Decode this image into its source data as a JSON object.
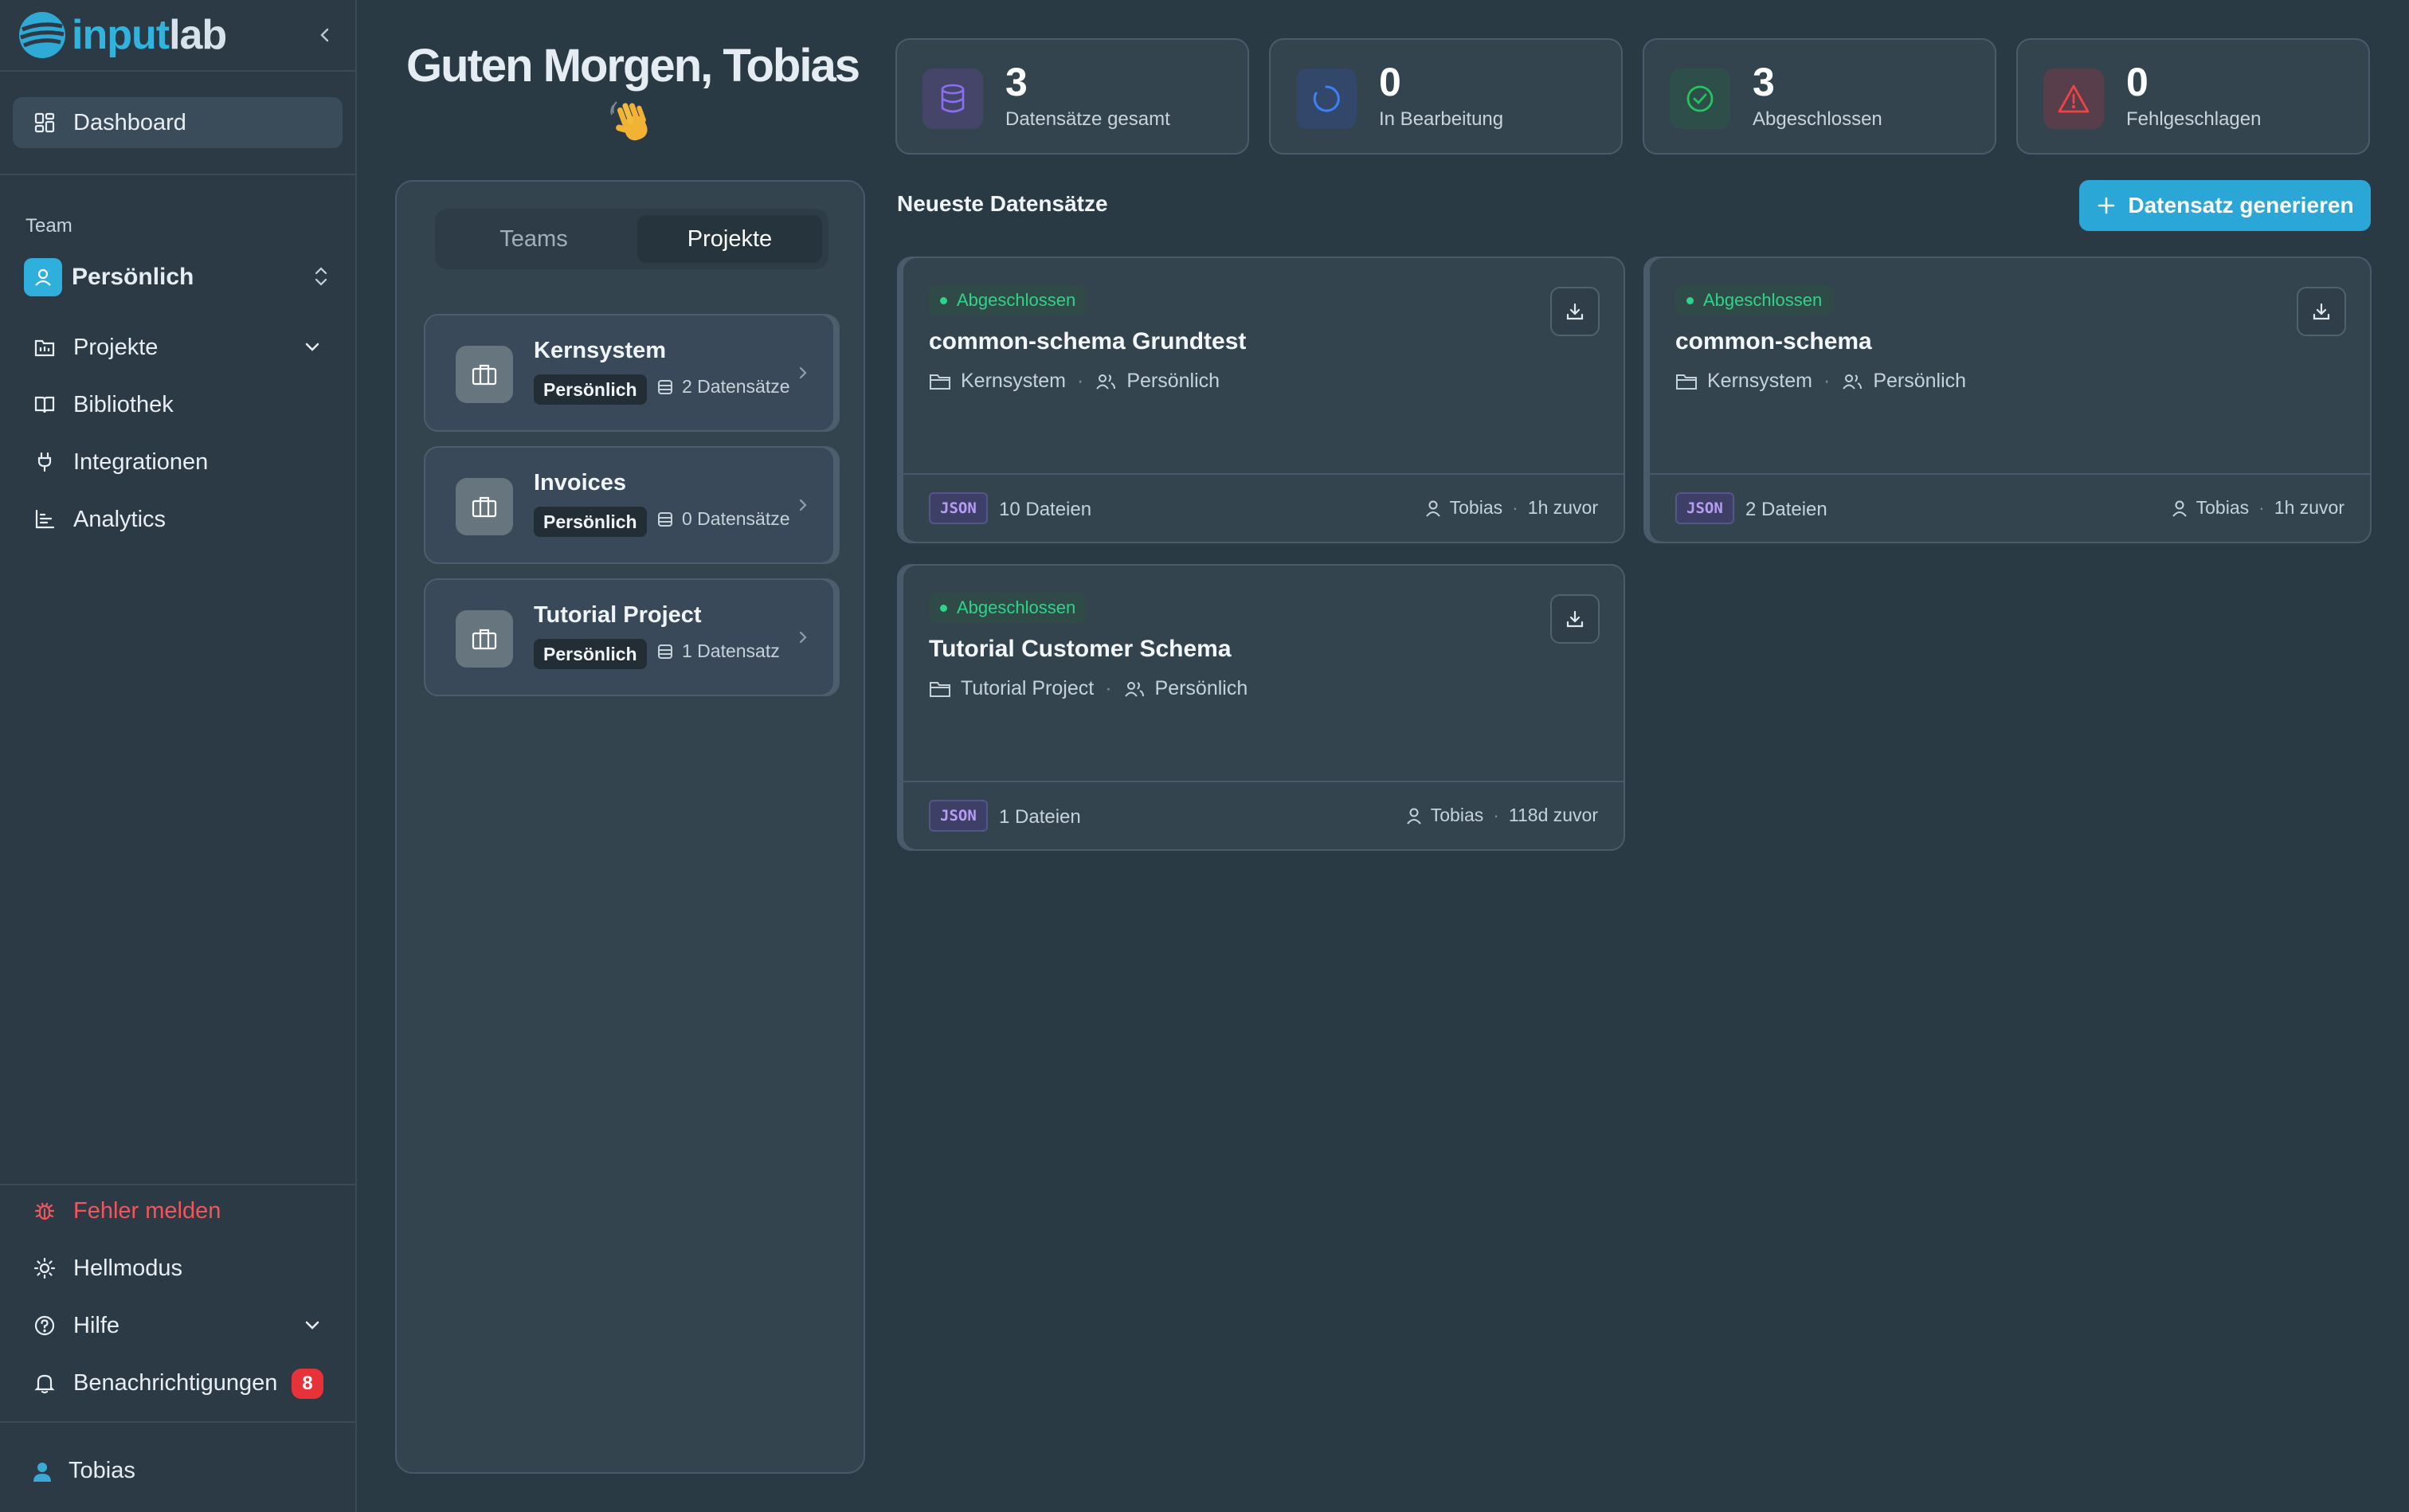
{
  "brand": {
    "name_part1": "input",
    "name_part2": "lab"
  },
  "sidebar": {
    "dashboard": "Dashboard",
    "team_label": "Team",
    "team_name": "Persönlich",
    "items": [
      {
        "label": "Projekte",
        "icon": "projects-icon"
      },
      {
        "label": "Bibliothek",
        "icon": "book-icon"
      },
      {
        "label": "Integrationen",
        "icon": "plug-icon"
      },
      {
        "label": "Analytics",
        "icon": "chart-icon"
      }
    ],
    "bottom": {
      "report": "Fehler melden",
      "theme": "Hellmodus",
      "help": "Hilfe",
      "notifications": "Benachrichtigungen",
      "notifications_count": "8"
    },
    "user": "Tobias"
  },
  "greeting": {
    "text": "Guten Morgen, Tobias",
    "emoji": "wave"
  },
  "panel": {
    "tabs": {
      "teams": "Teams",
      "projects": "Projekte"
    },
    "projects": [
      {
        "name": "Kernsystem",
        "tag": "Persönlich",
        "count": "2 Datensätze"
      },
      {
        "name": "Invoices",
        "tag": "Persönlich",
        "count": "0 Datensätze"
      },
      {
        "name": "Tutorial Project",
        "tag": "Persönlich",
        "count": "1 Datensatz"
      }
    ]
  },
  "stats": [
    {
      "value": "3",
      "label": "Datensätze gesamt",
      "color": "#8b6ff0"
    },
    {
      "value": "0",
      "label": "In Bearbeitung",
      "color": "#3b82f6"
    },
    {
      "value": "3",
      "label": "Abgeschlossen",
      "color": "#22c55e"
    },
    {
      "value": "0",
      "label": "Fehlgeschlagen",
      "color": "#ef4444"
    }
  ],
  "main": {
    "section_title": "Neueste Datensätze",
    "generate_button": "Datensatz generieren",
    "datasets": [
      {
        "status": "Abgeschlossen",
        "title": "common-schema Grundtest",
        "project": "Kernsystem",
        "team": "Persönlich",
        "format": "JSON",
        "files": "10 Dateien",
        "user": "Tobias",
        "time": "1h zuvor"
      },
      {
        "status": "Abgeschlossen",
        "title": "common-schema",
        "project": "Kernsystem",
        "team": "Persönlich",
        "format": "JSON",
        "files": "2 Dateien",
        "user": "Tobias",
        "time": "1h zuvor"
      },
      {
        "status": "Abgeschlossen",
        "title": "Tutorial Customer Schema",
        "project": "Tutorial Project",
        "team": "Persönlich",
        "format": "JSON",
        "files": "1 Dateien",
        "user": "Tobias",
        "time": "118d zuvor"
      }
    ]
  }
}
